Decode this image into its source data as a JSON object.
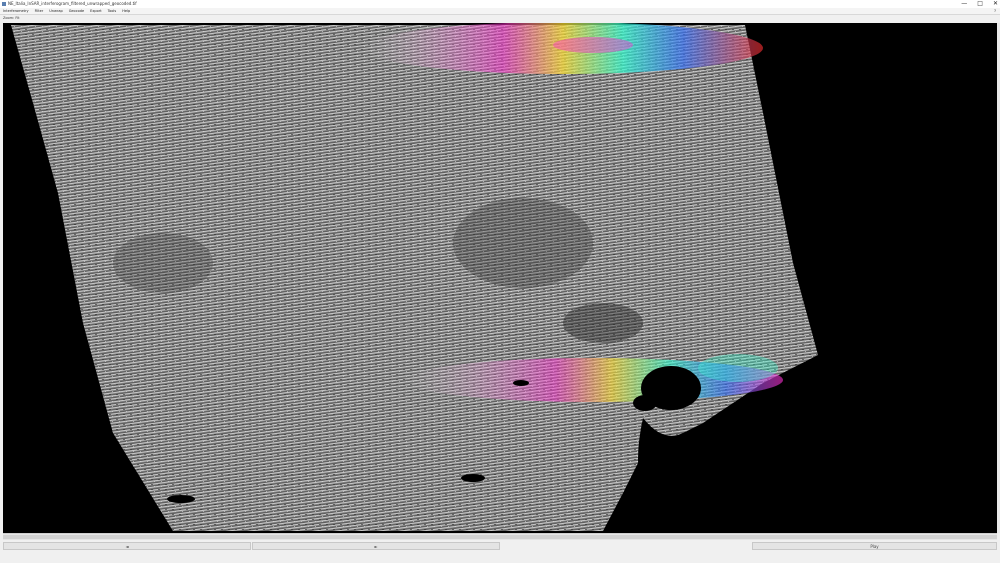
{
  "window": {
    "title": "NE_Italia_InSAR_interferogram_filtered_unwrapped_geocoded.tif",
    "buttons": [
      "—",
      "□",
      "✕"
    ]
  },
  "toolbar": {
    "items": [
      "Interferometry",
      "Filter",
      "Unwrap",
      "Geocode",
      "Export",
      "Tools",
      "Help"
    ],
    "right_label": "?"
  },
  "status": {
    "zoom_text": "Zoom: Fit"
  },
  "bottom": {
    "left_label": "◄",
    "mid_label": "►",
    "right_label": "Play"
  },
  "colors": {
    "background": "#000000",
    "swath_gray": "#8a8a8a",
    "fringe_colors": [
      "#ff2fd0",
      "#ffe030",
      "#30ffd0",
      "#3070ff",
      "#ff3030"
    ]
  }
}
